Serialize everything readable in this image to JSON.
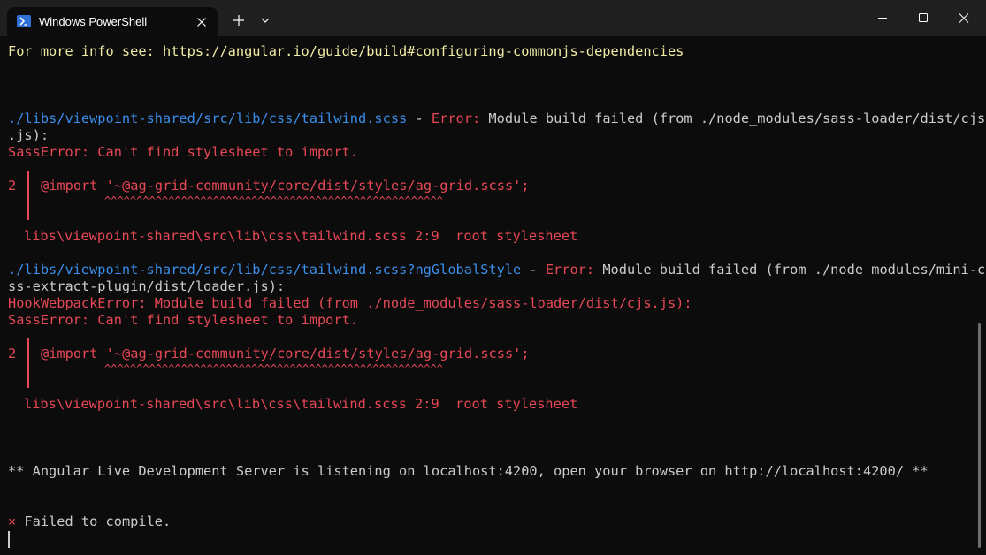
{
  "window": {
    "tab_title": "Windows PowerShell",
    "icons": {
      "tab": "powershell-icon",
      "close_tab": "close-icon",
      "new_tab": "plus-icon",
      "dropdown": "chevron-down-icon",
      "minimize": "minimize-icon",
      "maximize": "maximize-icon",
      "close": "close-icon"
    }
  },
  "colors": {
    "background": "#0c0c0c",
    "titlebar": "#1f1f1f",
    "text": "#cccccc",
    "yellow": "#f2eda6",
    "blue": "#3b8eea",
    "red": "#e74856"
  },
  "console": {
    "info_line": "For more info see: https://angular.io/guide/build#configuring-commonjs-dependencies",
    "error1": {
      "path": "./libs/viewpoint-shared/src/lib/css/tailwind.scss",
      "sep": " - ",
      "error_label": "Error:",
      "message": " Module build failed (from ./node_modules/sass-loader/dist/cjs",
      "message_cont": ".js):",
      "sass_error": "SassError: Can't find stylesheet to import.",
      "line_no": "2",
      "import_stmt": "@import '~@ag-grid-community/core/dist/styles/ag-grid.scss';",
      "carets": "^^^^^^^^^^^^^^^^^^^^^^^^^^^^^^^^^^^^^^^^^^^^^^^^^^^^^",
      "location": "libs\\viewpoint-shared\\src\\lib\\css\\tailwind.scss 2:9  root stylesheet"
    },
    "error2": {
      "path": "./libs/viewpoint-shared/src/lib/css/tailwind.scss?ngGlobalStyle",
      "sep": " - ",
      "error_label": "Error:",
      "message": " Module build failed (from ./node_modules/mini-c",
      "message_cont": "ss-extract-plugin/dist/loader.js):",
      "hook_error": "HookWebpackError: Module build failed (from ./node_modules/sass-loader/dist/cjs.js):",
      "sass_error": "SassError: Can't find stylesheet to import.",
      "line_no": "2",
      "import_stmt": "@import '~@ag-grid-community/core/dist/styles/ag-grid.scss';",
      "carets": "^^^^^^^^^^^^^^^^^^^^^^^^^^^^^^^^^^^^^^^^^^^^^^^^^^^^^",
      "location": "libs\\viewpoint-shared\\src\\lib\\css\\tailwind.scss 2:9  root stylesheet"
    },
    "server_line": "** Angular Live Development Server is listening on localhost:4200, open your browser on http://localhost:4200/ **",
    "fail_mark": "×",
    "fail_text": " Failed to compile."
  }
}
